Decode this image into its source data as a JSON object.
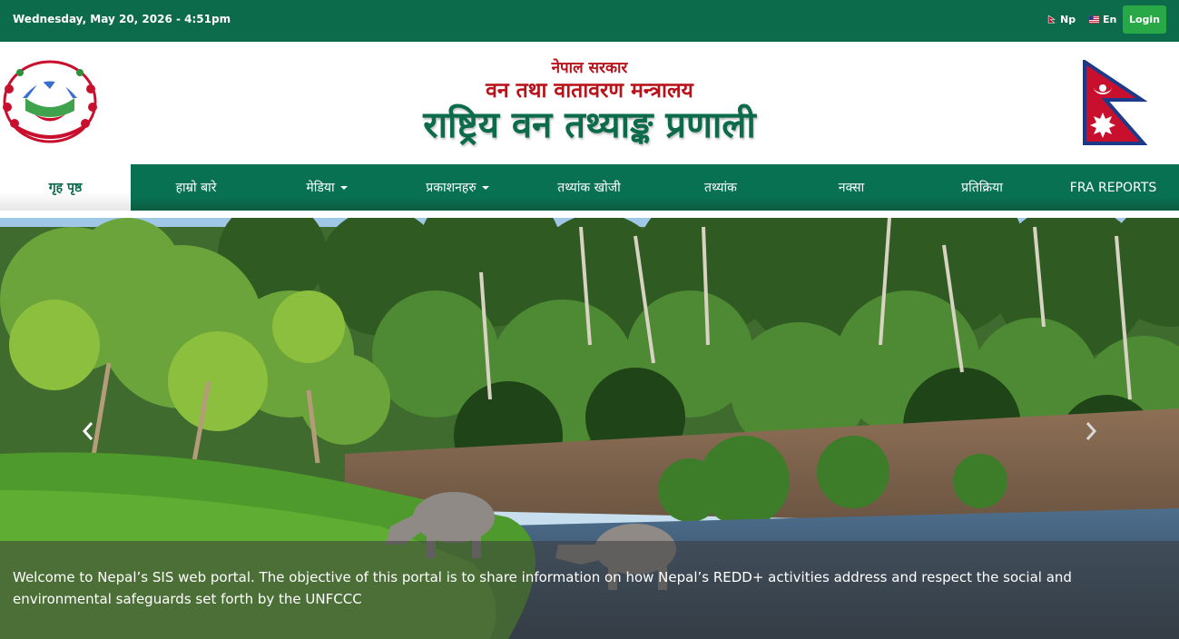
{
  "topbar": {
    "datetime": "Wednesday, May 20, 2026 - 4:51pm",
    "lang_np": "Np",
    "lang_en": "En",
    "login": "Login"
  },
  "header": {
    "government": "नेपाल सरकार",
    "ministry": "वन तथा वातावरण मन्त्रालय",
    "portal_title": "राष्ट्रिय वन तथ्याङ्क प्रणाली"
  },
  "nav": {
    "items": [
      {
        "label": "गृह पृष्ठ",
        "active": true,
        "dropdown": false
      },
      {
        "label": "हाम्रो बारे",
        "active": false,
        "dropdown": false
      },
      {
        "label": "मेडिया",
        "active": false,
        "dropdown": true
      },
      {
        "label": "प्रकाशनहरु",
        "active": false,
        "dropdown": true
      },
      {
        "label": "तथ्यांक खोजी",
        "active": false,
        "dropdown": false
      },
      {
        "label": "तथ्यांक",
        "active": false,
        "dropdown": false
      },
      {
        "label": "नक्सा",
        "active": false,
        "dropdown": false
      },
      {
        "label": "प्रतिक्रिया",
        "active": false,
        "dropdown": false
      },
      {
        "label": "FRA REPORTS",
        "active": false,
        "dropdown": false
      }
    ]
  },
  "slider": {
    "caption": "Welcome to Nepal’s SIS web portal. The objective of this portal is to share information on how Nepal’s REDD+ activities address and respect the social and environmental safeguards set forth by the UNFCCC"
  },
  "colors": {
    "brand_green": "#0b6b4a",
    "login_green": "#29a847",
    "header_red": "#b8121a"
  }
}
